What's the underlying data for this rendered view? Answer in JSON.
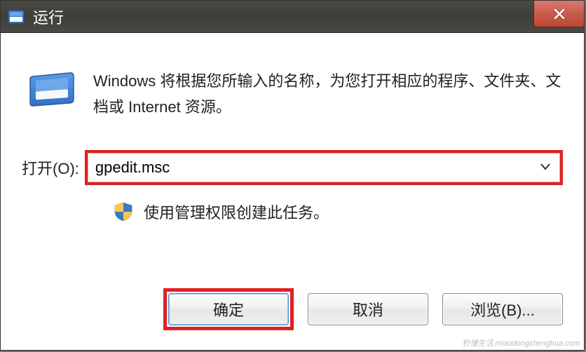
{
  "titlebar": {
    "title": "运行"
  },
  "content": {
    "description": "Windows 将根据您所输入的名称，为您打开相应的程序、文件夹、文档或 Internet 资源。",
    "open_label": "打开(O):",
    "input_value": "gpedit.msc",
    "admin_note": "使用管理权限创建此任务。"
  },
  "buttons": {
    "ok": "确定",
    "cancel": "取消",
    "browse": "浏览(B)..."
  },
  "watermark": "秒懂生活 miaodongshenghua.com"
}
